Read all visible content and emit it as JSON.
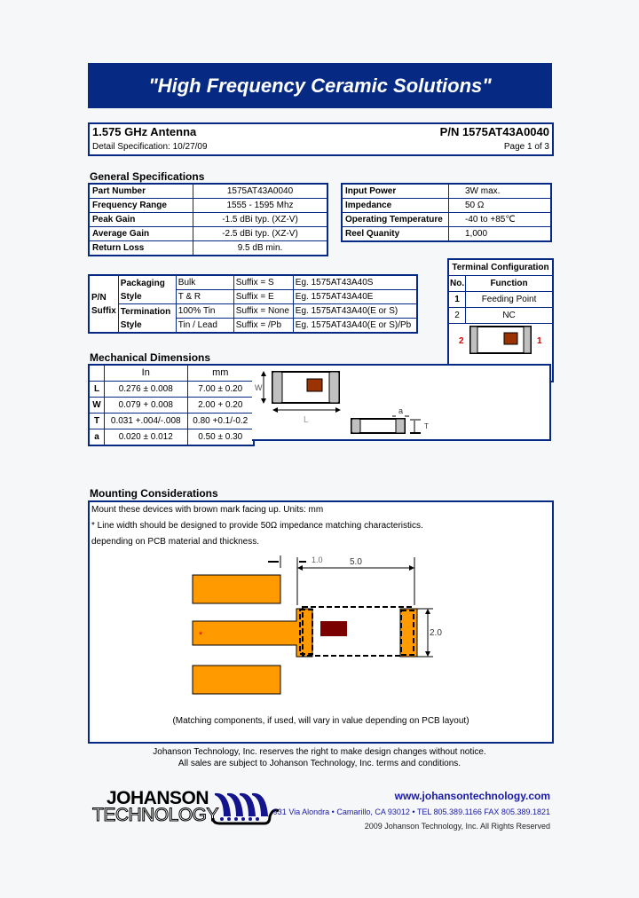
{
  "banner": {
    "title": "\"High Frequency Ceramic Solutions\""
  },
  "header": {
    "product": "1.575 GHz Antenna",
    "part_number": "P/N 1575AT43A0040",
    "detail_spec": "Detail Specification:  10/27/09",
    "page": "Page 1 of 3"
  },
  "general": {
    "title": "General Specifications",
    "left": [
      {
        "label": "Part Number",
        "value": "1575AT43A0040"
      },
      {
        "label": "Frequency Range",
        "value": "1555 - 1595 Mhz"
      },
      {
        "label": "Peak Gain",
        "value": "-1.5  dBi typ. (XZ-V)"
      },
      {
        "label": "Average Gain",
        "value": "-2.5  dBi typ. (XZ-V)"
      },
      {
        "label": "Return Loss",
        "value": "9.5 dB min."
      }
    ],
    "right": [
      {
        "label": "Input Power",
        "value": "3W max."
      },
      {
        "label": "Impedance",
        "value": "50 Ω"
      },
      {
        "label": "Operating Temperature",
        "value": "-40 to +85℃"
      },
      {
        "label": "Reel Quanity",
        "value": "1,000"
      }
    ]
  },
  "suffix": {
    "header": "P/N Suffix",
    "groups": [
      {
        "name": "Packaging Style",
        "rows": [
          {
            "option": "Bulk",
            "suffix": "Suffix = S",
            "example": "Eg. 1575AT43A40S"
          },
          {
            "option": "T & R",
            "suffix": "Suffix = E",
            "example": "Eg. 1575AT43A40E"
          }
        ]
      },
      {
        "name": "Termination Style",
        "rows": [
          {
            "option": "100% Tin",
            "suffix": "Suffix = None",
            "example": "Eg. 1575AT43A40(E or S)"
          },
          {
            "option": "Tin / Lead",
            "suffix": "Suffix = /Pb",
            "example": "Eg. 1575AT43A40(E or S)/Pb"
          }
        ]
      }
    ]
  },
  "terminal": {
    "title": "Terminal Configuration",
    "headers": [
      "No.",
      "Function"
    ],
    "rows": [
      {
        "no": "1",
        "function": "Feeding Point"
      },
      {
        "no": "2",
        "function": "NC"
      }
    ],
    "diagram_labels": {
      "left": "2",
      "right": "1"
    },
    "mark_color": "#9a3300",
    "label_color": "#d40000"
  },
  "mechanical": {
    "title": "Mechanical Dimensions",
    "headers": [
      "",
      "In",
      "mm"
    ],
    "rows": [
      {
        "dim": "L",
        "in": "0.276  ±  0.008",
        "mm": "7.00  ±  0.20"
      },
      {
        "dim": "W",
        "in": "0.079  +  0.008",
        "mm": "2.00  +  0.20"
      },
      {
        "dim": "T",
        "in": "0.031 +.004/-.008",
        "mm": "0.80   +0.1/-0.2"
      },
      {
        "dim": "a",
        "in": "0.020  ±  0.012",
        "mm": "0.50  ±  0.30"
      }
    ],
    "drawing_labels": {
      "w": "W",
      "l": "L",
      "a": "a",
      "t": "T"
    }
  },
  "mounting": {
    "title": "Mounting Considerations",
    "lines": [
      "Mount these devices with brown mark facing up. Units: mm",
      "* Line width should be designed to provide 50Ω impedance matching characteristics.",
      " depending on PCB material and thickness."
    ],
    "dims": {
      "gap": "1.0",
      "length": "5.0",
      "width": "2.0"
    },
    "feed_marker": "*",
    "note": "(Matching components, if used, will vary in value depending on PCB layout)",
    "pad_color": "#ff9a00",
    "mark_color": "#7a0000"
  },
  "footer": {
    "disclaimer1": "Johanson Technology, Inc. reserves the right to make design changes without notice.",
    "disclaimer2": "All sales are subject to Johanson Technology, Inc. terms and conditions.",
    "logo_line1": "JOHANSON",
    "logo_line2": "TECHNOLOGY",
    "website": "www.johansontechnology.com",
    "address": "931 Via Alondra • Camarillo, CA 93012 • TEL 805.389.1166   FAX 805.389.1821",
    "copyright": "2009 Johanson Technology, Inc.   All Rights Reserved"
  },
  "colors": {
    "brand_blue": "#062a84",
    "link_blue": "#1a1aa6"
  }
}
